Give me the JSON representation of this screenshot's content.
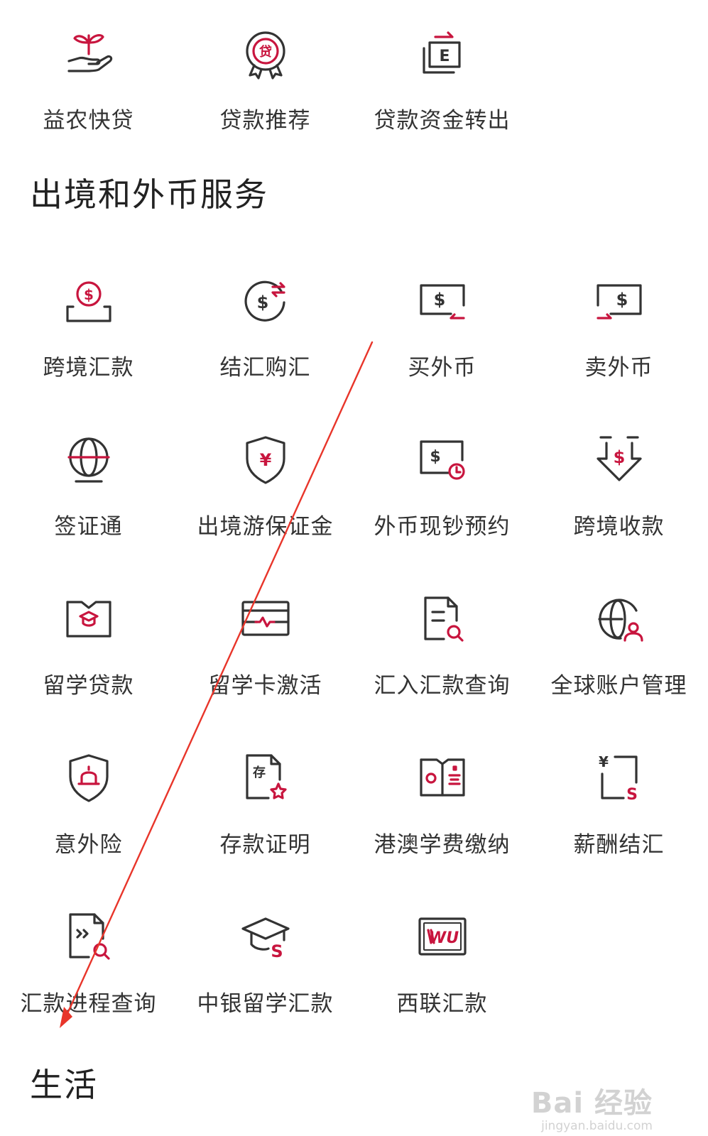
{
  "loan_items": [
    {
      "label": "益农快贷",
      "icon": "sprout-hand-icon"
    },
    {
      "label": "贷款推荐",
      "icon": "loan-badge-icon",
      "glyph": "贷"
    },
    {
      "label": "贷款资金转出",
      "icon": "e-transfer-icon",
      "glyph": "E"
    }
  ],
  "fx_section": {
    "title": "出境和外币服务"
  },
  "fx_items": [
    {
      "label": "跨境汇款",
      "icon": "coin-tray-icon"
    },
    {
      "label": "结汇购汇",
      "icon": "currency-exchange-icon"
    },
    {
      "label": "买外币",
      "icon": "buy-currency-icon"
    },
    {
      "label": "卖外币",
      "icon": "sell-currency-icon"
    },
    {
      "label": "签证通",
      "icon": "globe-icon"
    },
    {
      "label": "出境游保证金",
      "icon": "yen-shield-icon",
      "glyph": "¥"
    },
    {
      "label": "外币现钞预约",
      "icon": "cash-clock-icon"
    },
    {
      "label": "跨境收款",
      "icon": "receive-arrow-icon"
    },
    {
      "label": "留学贷款",
      "icon": "graduation-book-icon"
    },
    {
      "label": "留学卡激活",
      "icon": "card-pulse-icon"
    },
    {
      "label": "汇入汇款查询",
      "icon": "document-search-icon"
    },
    {
      "label": "全球账户管理",
      "icon": "globe-user-icon"
    },
    {
      "label": "意外险",
      "icon": "alarm-shield-icon"
    },
    {
      "label": "存款证明",
      "icon": "deposit-certificate-icon",
      "glyph": "存"
    },
    {
      "label": "港澳学费缴纳",
      "icon": "hk-macau-book-icon"
    },
    {
      "label": "薪酬结汇",
      "icon": "salary-exchange-icon",
      "glyph": "¥"
    },
    {
      "label": "汇款进程查询",
      "icon": "progress-search-icon"
    },
    {
      "label": "中银留学汇款",
      "icon": "graduation-cap-dollar-icon"
    },
    {
      "label": "西联汇款",
      "icon": "western-union-icon",
      "glyph": "WU"
    }
  ],
  "life_section": {
    "title": "生活"
  },
  "watermark": {
    "brand": "Bai 经验",
    "url": "jingyan.baidu.com"
  },
  "colors": {
    "accent": "#c8153e",
    "icon_stroke": "#333333",
    "annotation_arrow": "#e8352a"
  }
}
